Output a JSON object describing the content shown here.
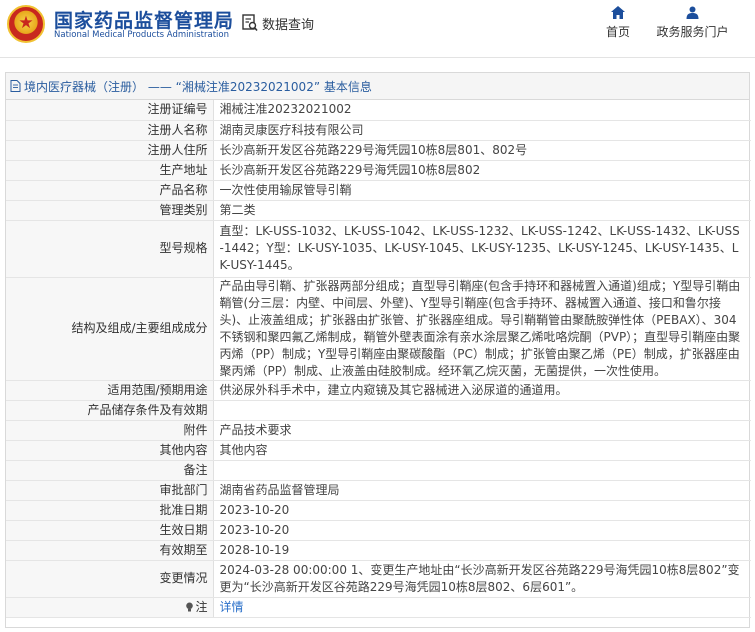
{
  "header": {
    "logo_cn": "国家药品监督管理局",
    "logo_en": "National Medical Products Administration",
    "query_label": "数据查询",
    "nav": {
      "home": "首页",
      "service": "政务服务门户"
    },
    "colors": {
      "brand": "#1c4e9c",
      "link": "#2a6fc9"
    }
  },
  "panel": {
    "title": "境内医疗器械（注册） —— “湘械注准20232021002” 基本信息"
  },
  "rows": {
    "reg_no": {
      "label": "注册证编号",
      "value": "湘械注准20232021002"
    },
    "registrant": {
      "label": "注册人名称",
      "value": "湖南灵康医疗科技有限公司"
    },
    "residence": {
      "label": "注册人住所",
      "value": "长沙高新开发区谷苑路229号海凭园10栋8层801、802号"
    },
    "production_address": {
      "label": "生产地址",
      "value": "长沙高新开发区谷苑路229号海凭园10栋8层802"
    },
    "product_name": {
      "label": "产品名称",
      "value": "一次性使用输尿管导引鞘"
    },
    "category": {
      "label": "管理类别",
      "value": "第二类"
    },
    "model_spec": {
      "label": "型号规格",
      "value": "直型：LK-USS-1032、LK-USS-1042、LK-USS-1232、LK-USS-1242、LK-USS-1432、LK-USS-1442；Y型：LK-USY-1035、LK-USY-1045、LK-USY-1235、LK-USY-1245、LK-USY-1435、LK-USY-1445。"
    },
    "structure": {
      "label": "结构及组成/主要组成成分",
      "value": "产品由导引鞘、扩张器两部分组成；直型导引鞘座(包含手持环和器械置入通道)组成；Y型导引鞘由鞘管(分三层：内壁、中间层、外壁)、Y型导引鞘座(包含手持环、器械置入通道、接口和鲁尔接头)、止液盖组成；扩张器由扩张管、扩张器座组成。导引鞘鞘管由聚酰胺弹性体（PEBAX）、304不锈钢和聚四氟乙烯制成，鞘管外壁表面涂有亲水涂层聚乙烯吡咯烷酮（PVP）；直型导引鞘座由聚丙烯（PP）制成；Y型导引鞘座由聚碳酸酯（PC）制成；扩张管由聚乙烯（PE）制成，扩张器座由聚丙烯（PP）制成、止液盖由硅胶制成。经环氧乙烷灭菌，无菌提供，一次性使用。"
    },
    "scope": {
      "label": "适用范围/预期用途",
      "value": "供泌尿外科手术中，建立内窥镜及其它器械进入泌尿道的通道用。"
    },
    "storage": {
      "label": "产品储存条件及有效期",
      "value": ""
    },
    "attachment": {
      "label": "附件",
      "value": "产品技术要求"
    },
    "other": {
      "label": "其他内容",
      "value": "其他内容"
    },
    "remarks": {
      "label": "备注",
      "value": ""
    },
    "approval_dept": {
      "label": "审批部门",
      "value": "湖南省药品监督管理局"
    },
    "approval_date": {
      "label": "批准日期",
      "value": "2023-10-20"
    },
    "effective_date": {
      "label": "生效日期",
      "value": "2023-10-20"
    },
    "valid_until": {
      "label": "有效期至",
      "value": "2028-10-19"
    },
    "changes": {
      "label": "变更情况",
      "value": "2024-03-28 00:00:00 1、变更生产地址由“长沙高新开发区谷苑路229号海凭园10栋8层802”变更为“长沙高新开发区谷苑路229号海凭园10栋8层802、6层601”。"
    },
    "note": {
      "label": "注",
      "value": "详情"
    }
  }
}
